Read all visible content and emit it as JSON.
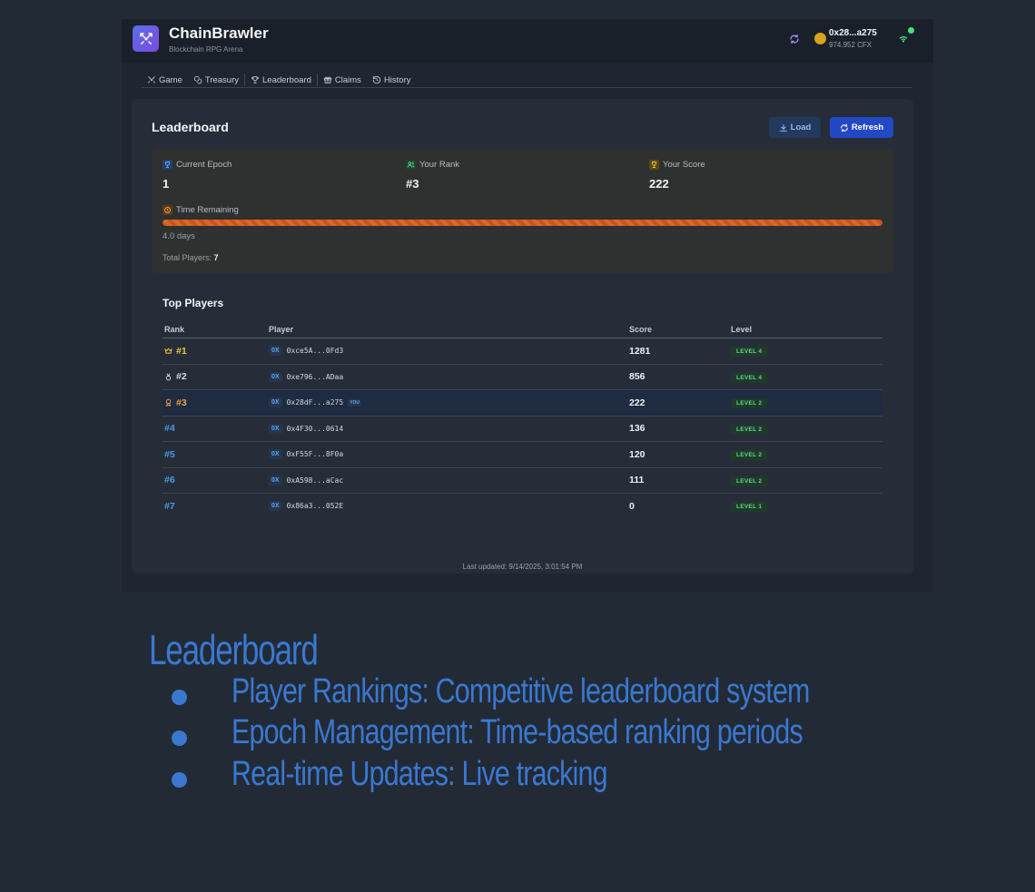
{
  "app": {
    "name": "ChainBrawler",
    "subtitle": "Blockchain RPG Arena",
    "wallet": {
      "address": "0x28...a275",
      "balance": "974.952 CFX"
    }
  },
  "tabs": [
    {
      "label": "Game",
      "icon": "swords-icon"
    },
    {
      "label": "Treasury",
      "icon": "coins-icon"
    },
    {
      "label": "Leaderboard",
      "icon": "trophy-icon"
    },
    {
      "label": "Claims",
      "icon": "gift-icon"
    },
    {
      "label": "History",
      "icon": "history-icon"
    }
  ],
  "leaderboard": {
    "title": "Leaderboard",
    "load_label": "Load",
    "refresh_label": "Refresh",
    "epoch": {
      "current_epoch_label": "Current Epoch",
      "current_epoch_value": "1",
      "your_rank_label": "Your Rank",
      "your_rank_value": "#3",
      "your_score_label": "Your Score",
      "your_score_value": "222",
      "time_remaining_label": "Time Remaining",
      "time_remaining_value": "4.0 days",
      "progress_fraction": 1.0,
      "total_players_label": "Total Players:",
      "total_players_value": "7"
    },
    "top_players": {
      "title": "Top Players",
      "columns": [
        "Rank",
        "Player",
        "Score",
        "Level"
      ],
      "rows": [
        {
          "rank": "#1",
          "medal": "crown-icon",
          "prefix": "0X",
          "address": "0xce5A...0Fd3",
          "you": "",
          "score": "1281",
          "level": "LEVEL 4"
        },
        {
          "rank": "#2",
          "medal": "medal-icon",
          "prefix": "0X",
          "address": "0xe796...ADaa",
          "you": "",
          "score": "856",
          "level": "LEVEL 4"
        },
        {
          "rank": "#3",
          "medal": "award-icon",
          "prefix": "0X",
          "address": "0x28dF...a275",
          "you": "YOU",
          "score": "222",
          "level": "LEVEL 2"
        },
        {
          "rank": "#4",
          "medal": "",
          "prefix": "0X",
          "address": "0x4F30...0614",
          "you": "",
          "score": "136",
          "level": "LEVEL 2"
        },
        {
          "rank": "#5",
          "medal": "",
          "prefix": "0X",
          "address": "0xF55F...8F0a",
          "you": "",
          "score": "120",
          "level": "LEVEL 2"
        },
        {
          "rank": "#6",
          "medal": "",
          "prefix": "0X",
          "address": "0xA598...aCac",
          "you": "",
          "score": "111",
          "level": "LEVEL 2"
        },
        {
          "rank": "#7",
          "medal": "",
          "prefix": "0X",
          "address": "0x86a3...052E",
          "you": "",
          "score": "0",
          "level": "LEVEL 1"
        }
      ]
    },
    "last_updated": "Last updated: 9/14/2025, 3:01:54 PM"
  },
  "slide": {
    "title": "Leaderboard",
    "bullets": [
      "Player Rankings: Competitive leaderboard system",
      "Epoch Management: Time-based ranking periods",
      "Real-time Updates: Live tracking"
    ]
  },
  "colors": {
    "accent": "#2348c4",
    "slide_text": "#3a78d0",
    "gold": "#f2c14e",
    "bronze": "#f0a04b",
    "rank_blue": "#4a9ae8",
    "level_green": "#62d68a",
    "progress": "#c9541b"
  }
}
